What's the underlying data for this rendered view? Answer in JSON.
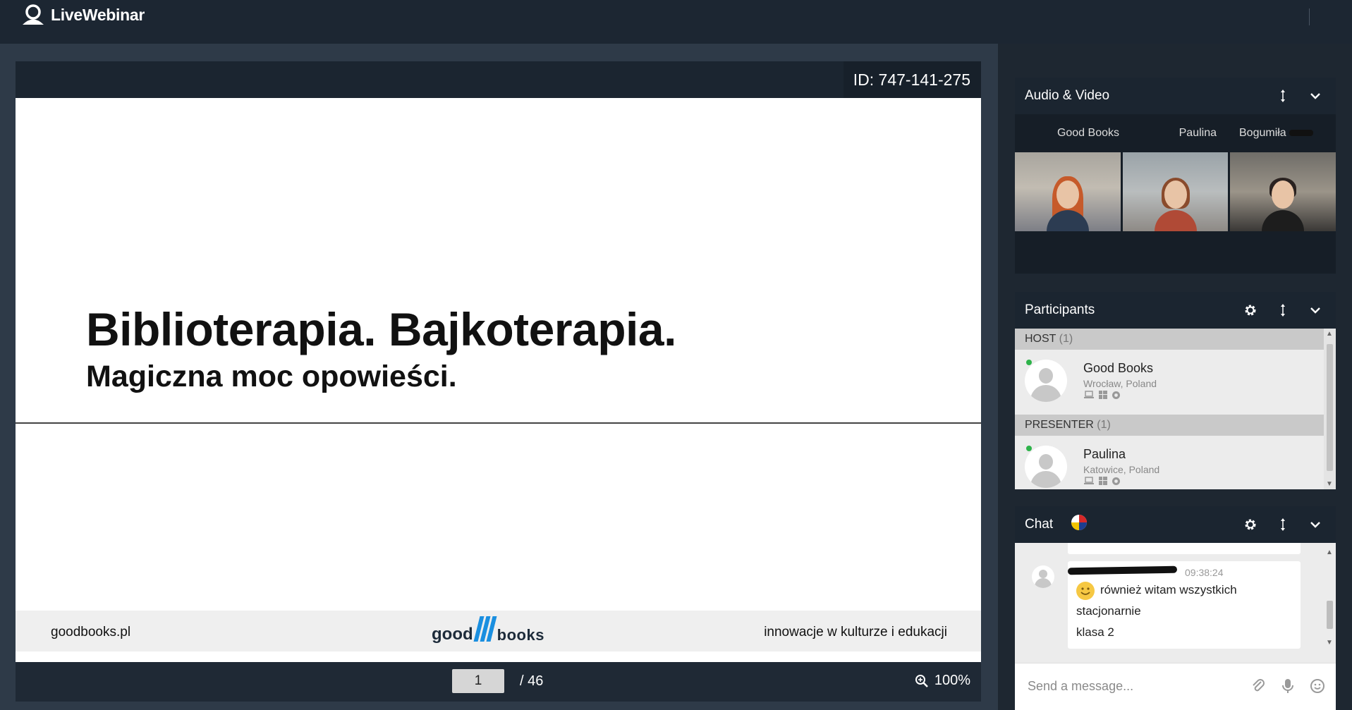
{
  "app": {
    "name": "LiveWebinar"
  },
  "presentation": {
    "meeting_id": "ID: 747-141-275",
    "slide": {
      "title": "Biblioterapia. Bajkoterapia.",
      "subtitle": "Magiczna moc opowieści.",
      "footer_left": "goodbooks.pl",
      "footer_logo_left": "good",
      "footer_logo_right": "books",
      "footer_right": "innowacje w kulturze i edukacji"
    },
    "pager": {
      "current_page": "1",
      "total": "/ 46",
      "zoom": "100%"
    }
  },
  "audio_video": {
    "title": "Audio & Video",
    "streams": [
      {
        "name": "Good Books"
      },
      {
        "name": "Paulina"
      },
      {
        "name": "Bogumiła"
      }
    ]
  },
  "participants": {
    "title": "Participants",
    "groups": [
      {
        "label": "HOST",
        "count": "(1)",
        "members": [
          {
            "name": "Good Books",
            "location": "Wrocław, Poland"
          }
        ]
      },
      {
        "label": "PRESENTER",
        "count": "(1)",
        "members": [
          {
            "name": "Paulina",
            "location": "Katowice, Poland"
          }
        ]
      }
    ]
  },
  "chat": {
    "title": "Chat",
    "messages": [
      {
        "time": "09:38:24",
        "lines": [
          "również witam wszystkich",
          "stacjonarnie",
          "klasa 2"
        ]
      }
    ],
    "input_placeholder": "Send a message..."
  },
  "colors": {
    "accent_blue": "#1a8fe0",
    "online_green": "#2eb34a",
    "header_dark": "#1b2530"
  }
}
